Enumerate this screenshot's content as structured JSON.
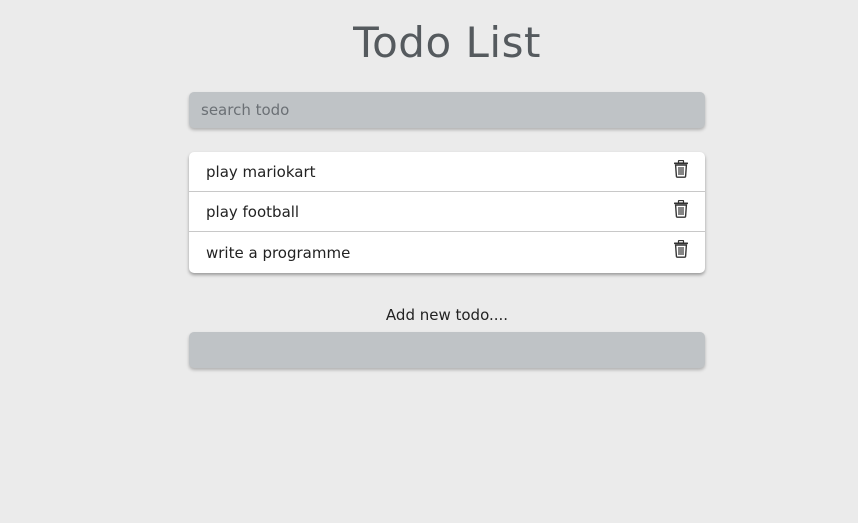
{
  "header": {
    "title": "Todo List"
  },
  "search": {
    "placeholder": "search todo",
    "value": ""
  },
  "todos": [
    {
      "text": "play mariokart",
      "delete_icon": "trash-icon"
    },
    {
      "text": "play football",
      "delete_icon": "trash-icon"
    },
    {
      "text": "write a programme",
      "delete_icon": "trash-icon"
    }
  ],
  "add_form": {
    "label": "Add new todo....",
    "value": ""
  },
  "colors": {
    "background": "#ebebeb",
    "input_background": "#bfc3c6",
    "title_text": "#555a5e",
    "list_background": "#ffffff"
  }
}
